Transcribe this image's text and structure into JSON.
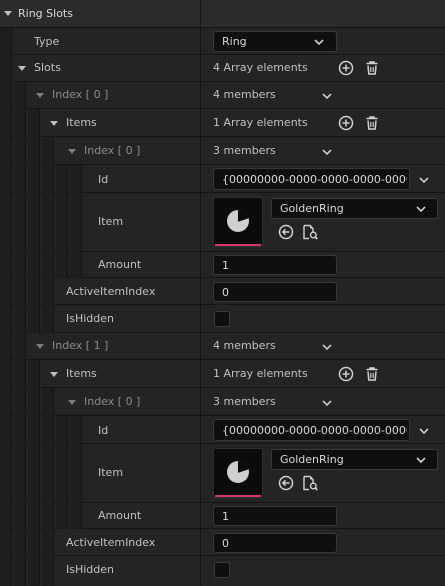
{
  "root": {
    "label": "Ring Slots"
  },
  "type_row": {
    "label": "Type",
    "value": "Ring"
  },
  "slots_row": {
    "label": "Slots",
    "value": "4 Array elements"
  },
  "slots": [
    {
      "index_label": "Index [ 0 ]",
      "members": "4 members",
      "items_label": "Items",
      "items_value": "1 Array elements",
      "inner_index_label": "Index [ 0 ]",
      "inner_members": "3 members",
      "id_label": "Id",
      "id_value": "{00000000-0000-0000-0000-00000",
      "item_label": "Item",
      "item_value": "GoldenRing",
      "amount_label": "Amount",
      "amount_value": "1",
      "active_label": "ActiveItemIndex",
      "active_value": "0",
      "hidden_label": "IsHidden"
    },
    {
      "index_label": "Index [ 1 ]",
      "members": "4 members",
      "items_label": "Items",
      "items_value": "1 Array elements",
      "inner_index_label": "Index [ 0 ]",
      "inner_members": "3 members",
      "id_label": "Id",
      "id_value": "{00000000-0000-0000-0000-00000",
      "item_label": "Item",
      "item_value": "GoldenRing",
      "amount_label": "Amount",
      "amount_value": "1",
      "active_label": "ActiveItemIndex",
      "active_value": "0",
      "hidden_label": "IsHidden"
    }
  ],
  "colors": {
    "accent_bar": "#d6336c",
    "panel_bg": "#242424",
    "field_bg": "#0f0f0f"
  },
  "icons": [
    "expand-arrow-icon",
    "chevron-down-icon",
    "add-element-icon",
    "delete-icon",
    "browse-to-asset-icon",
    "use-selected-asset-icon",
    "asset-thumbnail-icon"
  ]
}
